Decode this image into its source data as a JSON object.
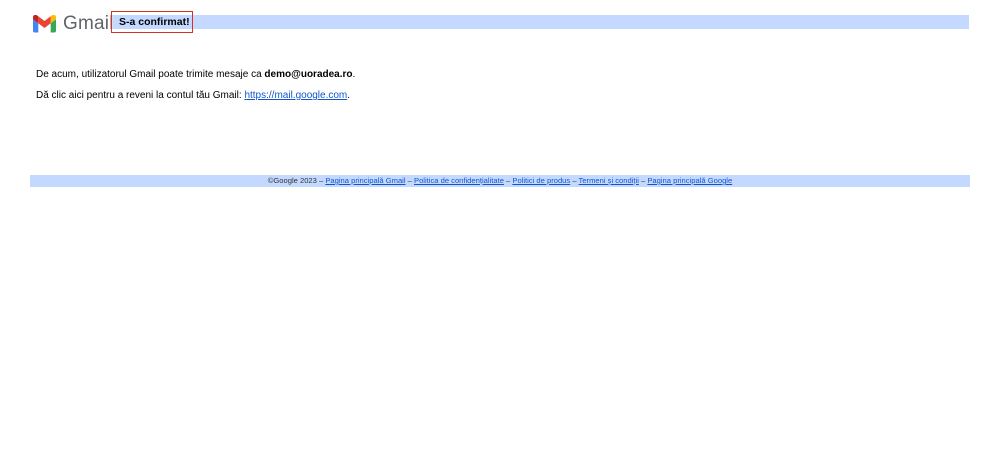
{
  "header": {
    "logo_text": "Gmail",
    "status": "S-a confirmat!"
  },
  "content": {
    "line1_prefix": "De acum, utilizatorul Gmail poate trimite mesaje ca ",
    "email": "demo@uoradea.ro",
    "line1_suffix": ".",
    "line2_prefix": "Dă clic aici pentru a reveni la contul tău Gmail: ",
    "link_text": "https://mail.google.com",
    "line2_suffix": "."
  },
  "footer": {
    "copyright": "©Google 2023",
    "separator": " – ",
    "links": [
      "Pagina principală Gmail",
      "Politica de confidențialitate",
      "Politici de produs",
      "Termeni și condiții",
      "Pagina principală Google"
    ]
  },
  "colors": {
    "bar": "#c3d9ff",
    "status_border": "#d93025",
    "link": "#1155cc"
  },
  "icons": {
    "logo": "gmail-logo-icon"
  }
}
